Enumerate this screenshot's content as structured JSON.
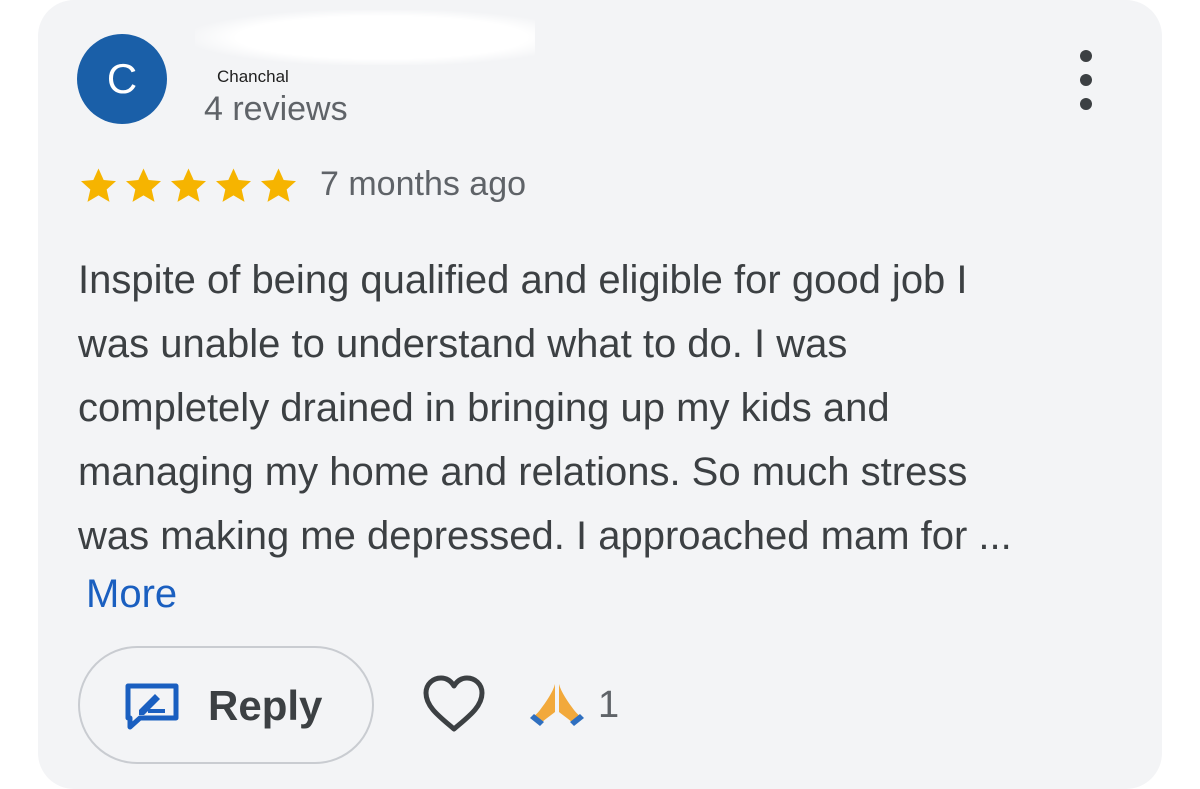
{
  "reviewer": {
    "avatar_letter": "C",
    "avatar_color": "#1a5fa8",
    "name": "Chanchal",
    "review_count": "4 reviews"
  },
  "menu": {
    "icon": "more-vert-icon"
  },
  "rating": {
    "stars": 5,
    "max_stars": 5,
    "star_color": "#f6b400",
    "time_ago": "7 months ago"
  },
  "review": {
    "lines": [
      "Inspite of being qualified and eligible for good job I",
      "was unable to understand what to do. I was",
      "completely drained in bringing up my kids and",
      "managing my home and relations. So much stress",
      "was making me depressed. I approached mam for ..."
    ],
    "more_label": "More",
    "link_color": "#1a5fc0"
  },
  "actions": {
    "reply_label": "Reply",
    "reply_icon": "reply-edit-icon",
    "like_icon": "heart-outline-icon",
    "reaction_icon": "folded-hands-emoji",
    "reaction_count": "1"
  }
}
